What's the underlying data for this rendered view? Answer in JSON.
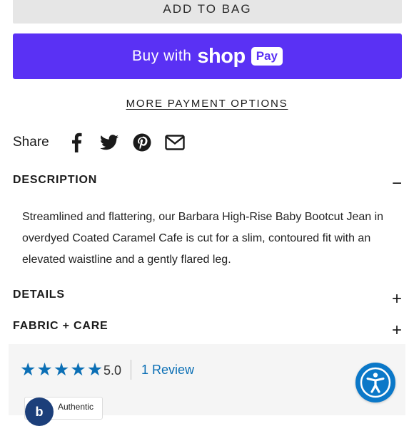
{
  "add_to_bag": {
    "label": "ADD TO BAG"
  },
  "shop_pay": {
    "buy_with": "Buy with",
    "shop": "shop",
    "pay": "Pay",
    "color": "#5a31f4"
  },
  "more_payment": {
    "label": "MORE PAYMENT OPTIONS"
  },
  "share": {
    "label": "Share",
    "icons": [
      "facebook-icon",
      "twitter-icon",
      "pinterest-icon",
      "email-icon"
    ]
  },
  "description": {
    "title": "DESCRIPTION",
    "toggle": "−",
    "body": "Streamlined and flattering, our Barbara High-Rise Baby Bootcut Jean in overdyed Coated Caramel Cafe is cut for a slim, contoured fit with an elevated waistline and a gently flared leg."
  },
  "details": {
    "title": "DETAILS",
    "toggle": "+"
  },
  "fabric_care": {
    "title": "FABRIC + CARE",
    "toggle": "+"
  },
  "reviews": {
    "stars": 5,
    "rating": "5.0",
    "review_link": "1 Review",
    "badge_text": "Authentic",
    "badge_logo": "b",
    "star_color": "#0b6fb5"
  },
  "accessibility": {
    "icon": "accessibility-icon",
    "color": "#0b78c8"
  }
}
